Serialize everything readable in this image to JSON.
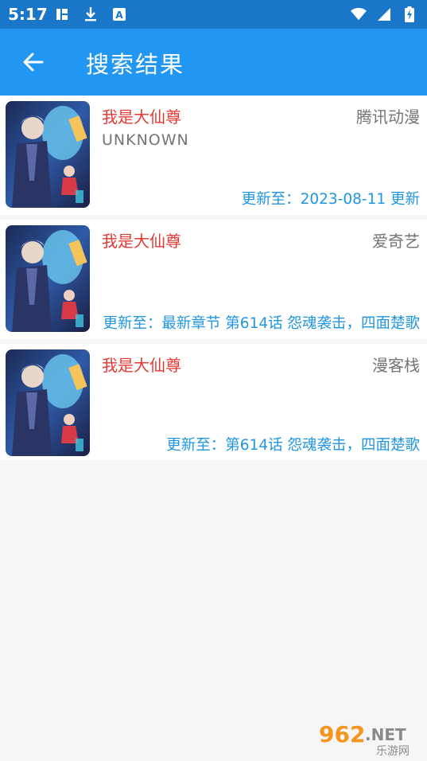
{
  "status_bar": {
    "time": "5:17"
  },
  "app_bar": {
    "title": "搜索结果",
    "back_icon": "arrow-left-icon"
  },
  "results": [
    {
      "title": "我是大仙尊",
      "source": "腾讯动漫",
      "author": "UNKNOWN",
      "update": "更新至：2023-08-11 更新"
    },
    {
      "title": "我是大仙尊",
      "source": "爱奇艺",
      "author": "",
      "update": "更新至：最新章节 第614话 怨魂袭击，四面楚歌"
    },
    {
      "title": "我是大仙尊",
      "source": "漫客栈",
      "author": "",
      "update": "更新至：第614话 怨魂袭击，四面楚歌"
    }
  ],
  "watermark": {
    "number": "962",
    "suffix": ".NET",
    "sub": "乐游网"
  },
  "colors": {
    "status_bar": "#1976c8",
    "app_bar": "#2196f3",
    "title_red": "#e53935",
    "update_blue": "#2196e0",
    "gray_text": "#757575"
  }
}
